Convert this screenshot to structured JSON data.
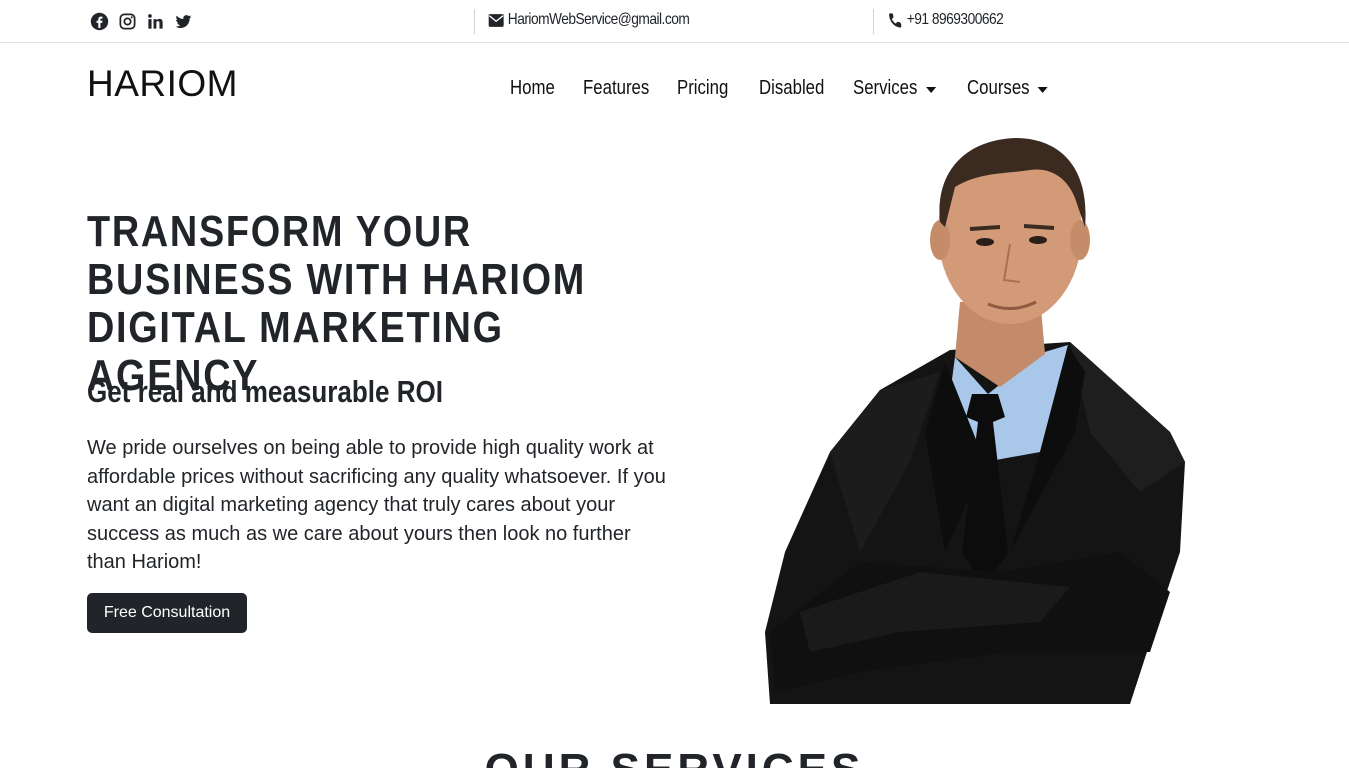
{
  "topbar": {
    "social_icons": [
      "facebook-icon",
      "instagram-icon",
      "linkedin-icon",
      "twitter-icon"
    ],
    "email": "HariomWebService@gmail.com",
    "email_icon": "envelope-icon",
    "phone": "+91 8969300662",
    "phone_icon": "phone-icon"
  },
  "navbar": {
    "brand": "HARIOM",
    "items": [
      {
        "label": "Home"
      },
      {
        "label": "Features"
      },
      {
        "label": "Pricing"
      },
      {
        "label": "Disabled"
      },
      {
        "label": "Services",
        "dropdown": true
      },
      {
        "label": "Courses",
        "dropdown": true
      }
    ]
  },
  "hero": {
    "title": "TRANSFORM YOUR BUSINESS WITH HARIOM DIGITAL MARKETING AGENCY",
    "subtitle": "Get real and measurable ROI",
    "description": "We pride ourselves on being able to provide high quality work at affordable prices without sacrificing any quality whatsoever. If you want an digital marketing agency that truly cares about your success as much as we care about yours then look no further than Hariom!",
    "cta_label": "Free Consultation"
  },
  "services": {
    "title": "OUR SERVICES"
  },
  "colors": {
    "text": "#212529",
    "button_bg": "#212529",
    "button_text": "#ffffff",
    "border": "#dee2e6"
  }
}
